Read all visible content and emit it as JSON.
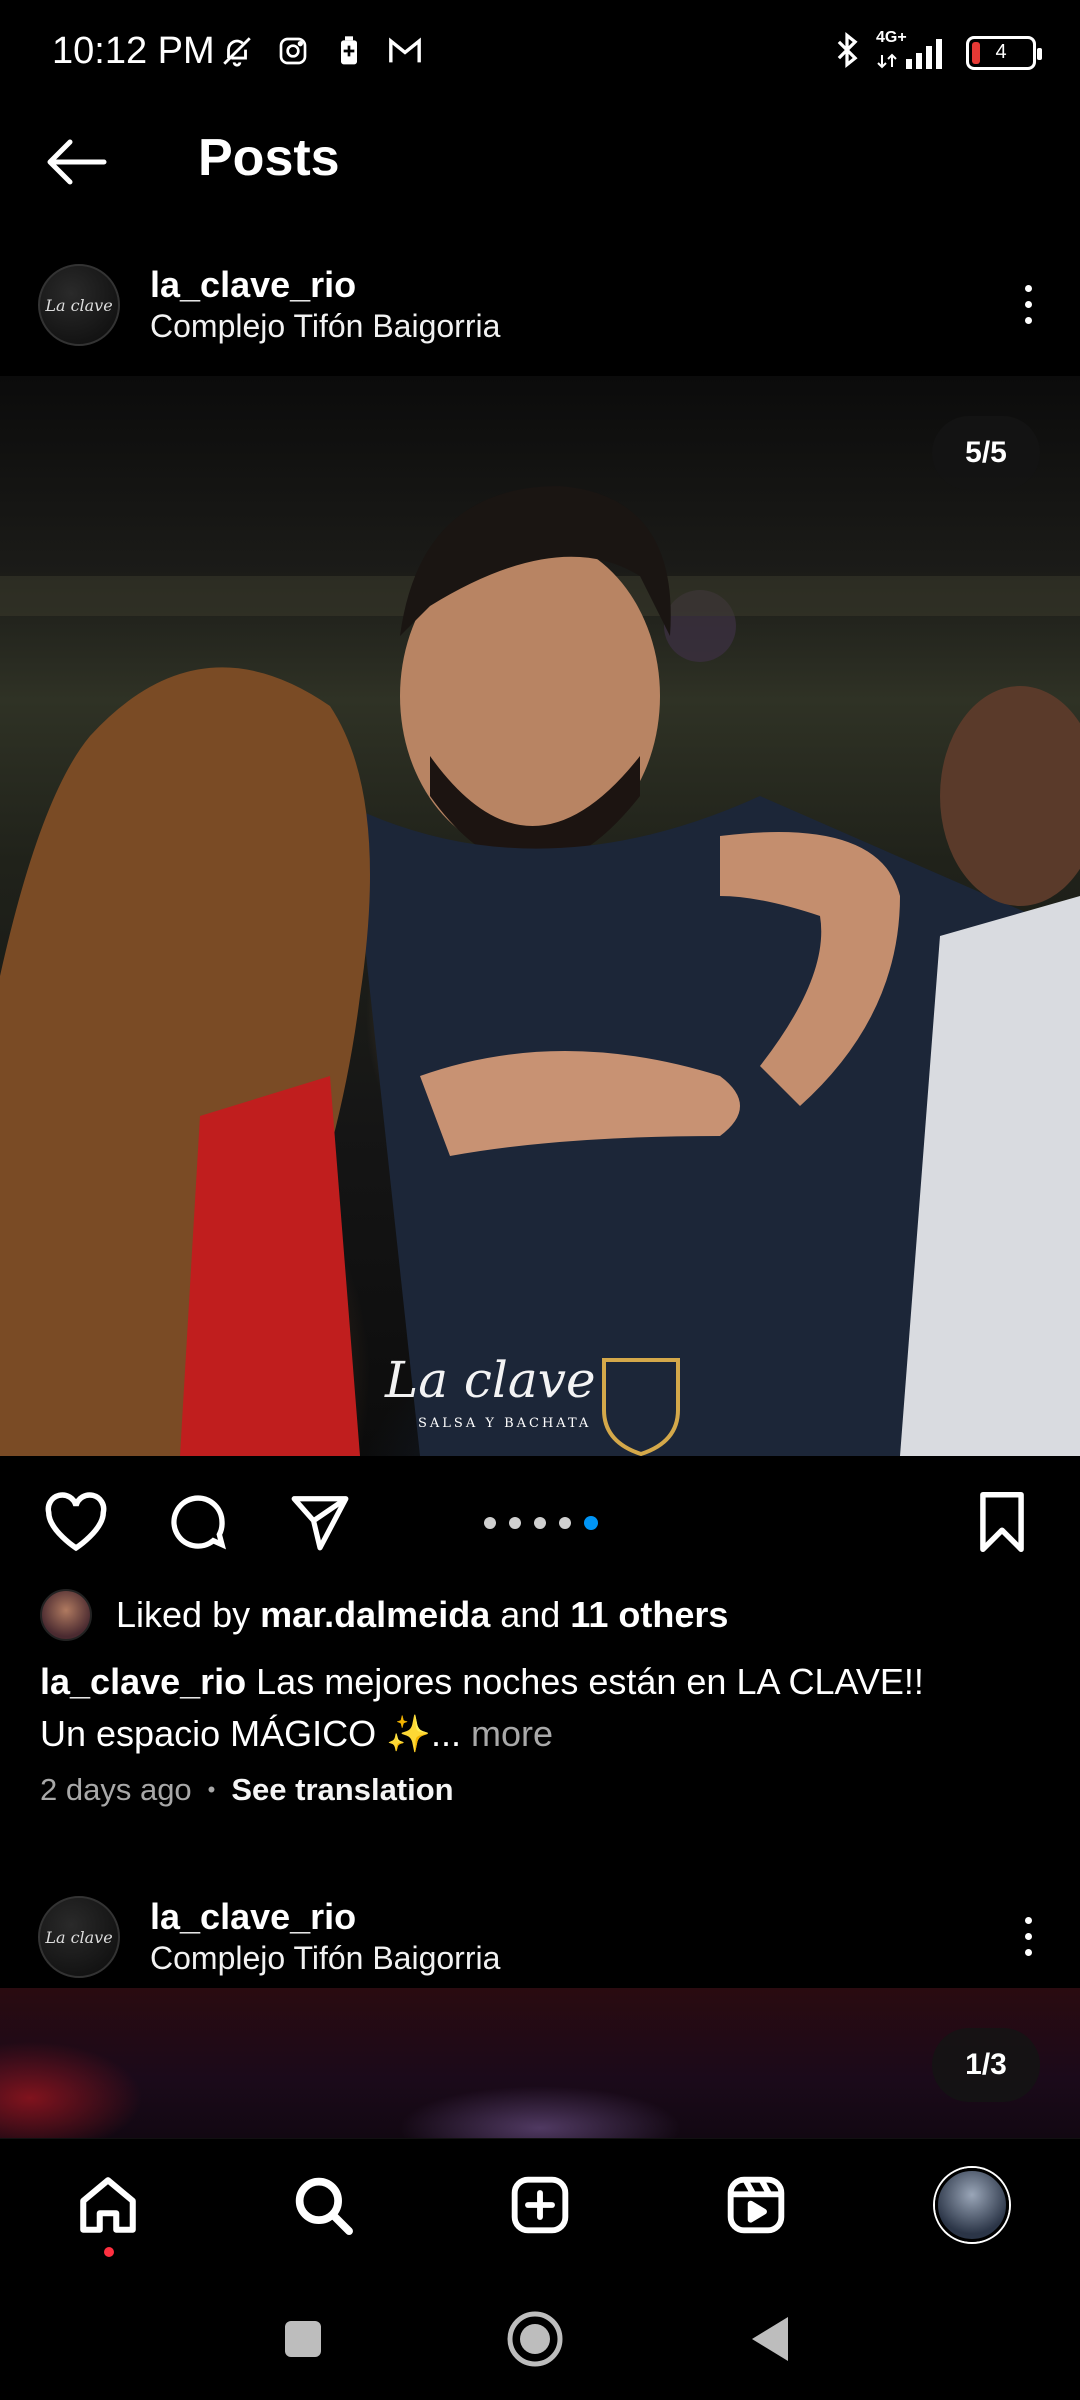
{
  "status_bar": {
    "time": "10:12 PM",
    "network": "4G+",
    "battery": "4"
  },
  "header": {
    "title": "Posts"
  },
  "posts": [
    {
      "username": "la_clave_rio",
      "location": "Complejo Tifón Baigorria",
      "counter": "5/5",
      "watermark": "La clave",
      "watermark_sub": "SALSA Y BACHATA",
      "liked_by_prefix": "Liked by ",
      "liked_by_user": "mar.dalmeida",
      "liked_by_and": " and ",
      "liked_by_others": "11 others",
      "caption_user": "la_clave_rio",
      "caption_line1": " Las mejores noches están en LA CLAVE!!",
      "caption_line2": "Un espacio MÁGICO ✨...",
      "caption_more": " more",
      "time_ago": "2 days ago",
      "see_translation": "See translation",
      "carousel_active_index": 5,
      "carousel_total": 5
    },
    {
      "username": "la_clave_rio",
      "location": "Complejo Tifón Baigorria",
      "counter": "1/3"
    }
  ],
  "icons": {
    "back": "arrow-left-icon",
    "more": "more-vertical-icon",
    "like": "heart-icon",
    "comment": "comment-icon",
    "share": "send-icon",
    "save": "bookmark-icon",
    "home": "home-icon",
    "search": "search-icon",
    "create": "add-square-icon",
    "reels": "reels-icon"
  },
  "colors": {
    "background": "#000000",
    "accent_blue": "#0095f6",
    "notification_red": "#ff3040",
    "muted_text": "#a8a8a8"
  }
}
